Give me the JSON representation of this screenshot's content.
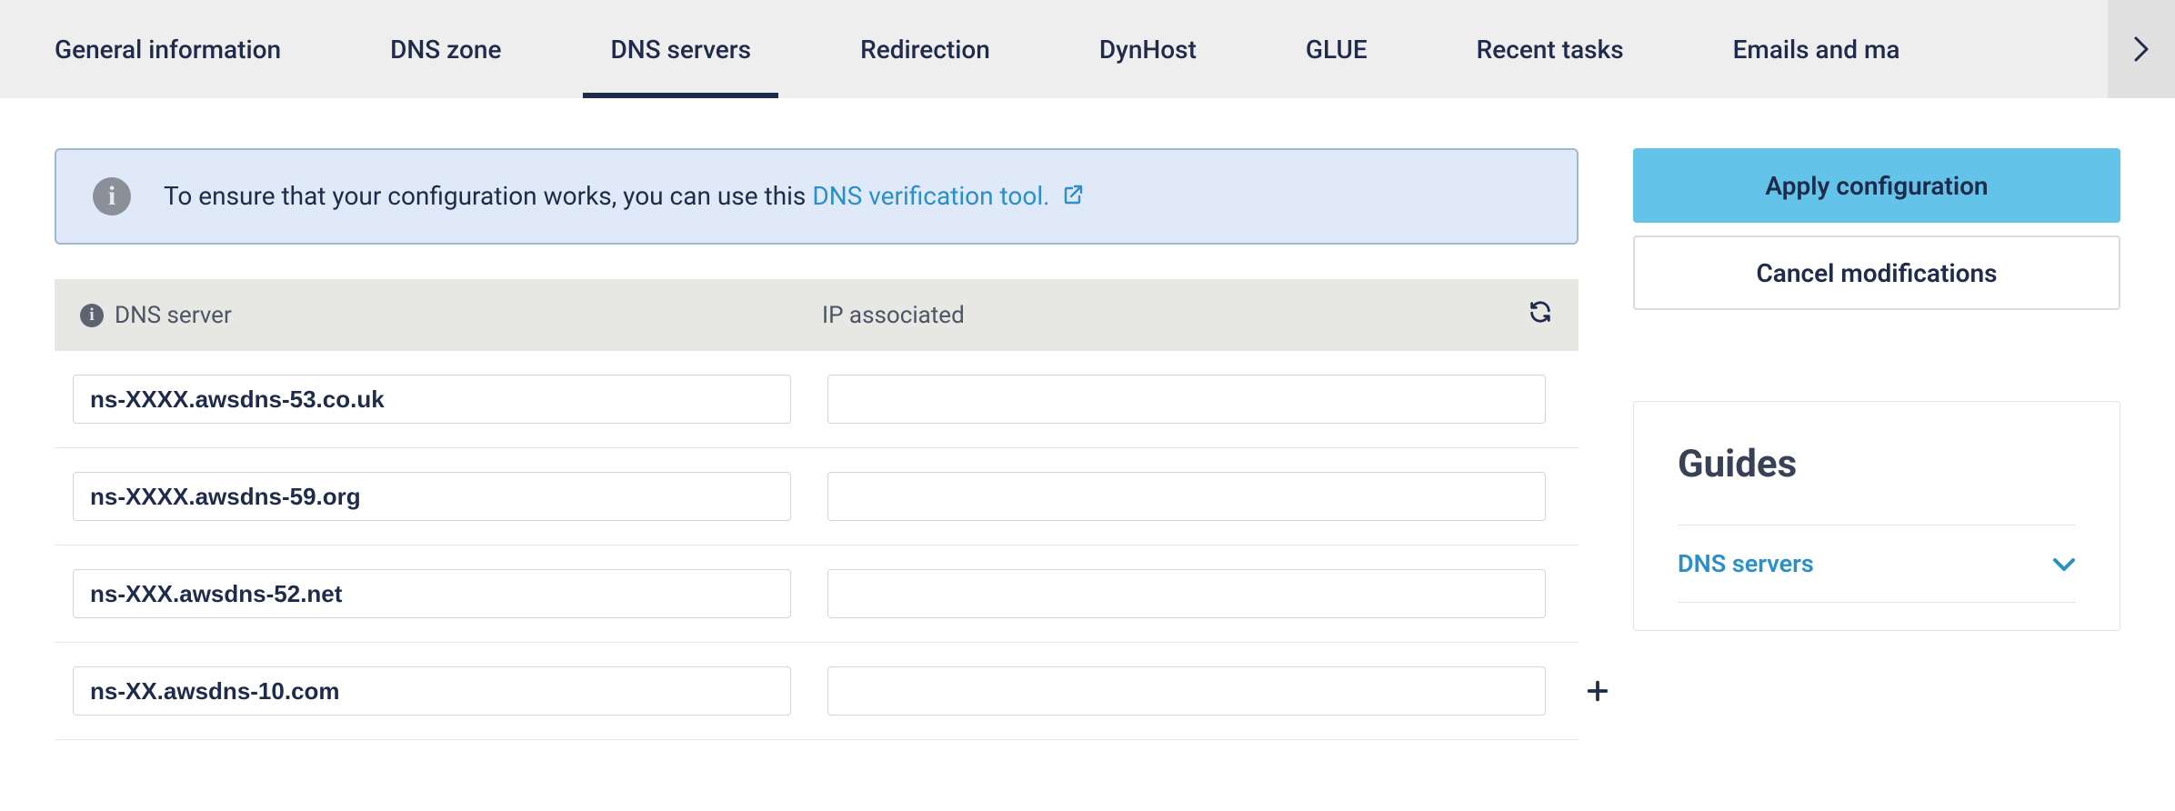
{
  "tabs": [
    {
      "id": "general",
      "label": "General information",
      "active": false
    },
    {
      "id": "dnszone",
      "label": "DNS zone",
      "active": false
    },
    {
      "id": "dnsservers",
      "label": "DNS servers",
      "active": true
    },
    {
      "id": "redirection",
      "label": "Redirection",
      "active": false
    },
    {
      "id": "dynhost",
      "label": "DynHost",
      "active": false
    },
    {
      "id": "glue",
      "label": "GLUE",
      "active": false
    },
    {
      "id": "recent",
      "label": "Recent tasks",
      "active": false
    },
    {
      "id": "emails",
      "label": "Emails and ma",
      "active": false,
      "truncated": true
    }
  ],
  "info_banner": {
    "text_before_link": "To ensure that your configuration works, you can use this ",
    "link_text": "DNS verification tool."
  },
  "table": {
    "header_dns": "DNS server",
    "header_ip": "IP associated",
    "rows": [
      {
        "dns": "ns-XXXX.awsdns-53.co.uk",
        "ip": ""
      },
      {
        "dns": "ns-XXXX.awsdns-59.org",
        "ip": ""
      },
      {
        "dns": "ns-XXX.awsdns-52.net",
        "ip": ""
      },
      {
        "dns": "ns-XX.awsdns-10.com",
        "ip": "",
        "add": true
      }
    ]
  },
  "actions": {
    "apply": "Apply configuration",
    "cancel": "Cancel modifications"
  },
  "guides": {
    "title": "Guides",
    "items": [
      {
        "label": "DNS servers"
      }
    ]
  }
}
